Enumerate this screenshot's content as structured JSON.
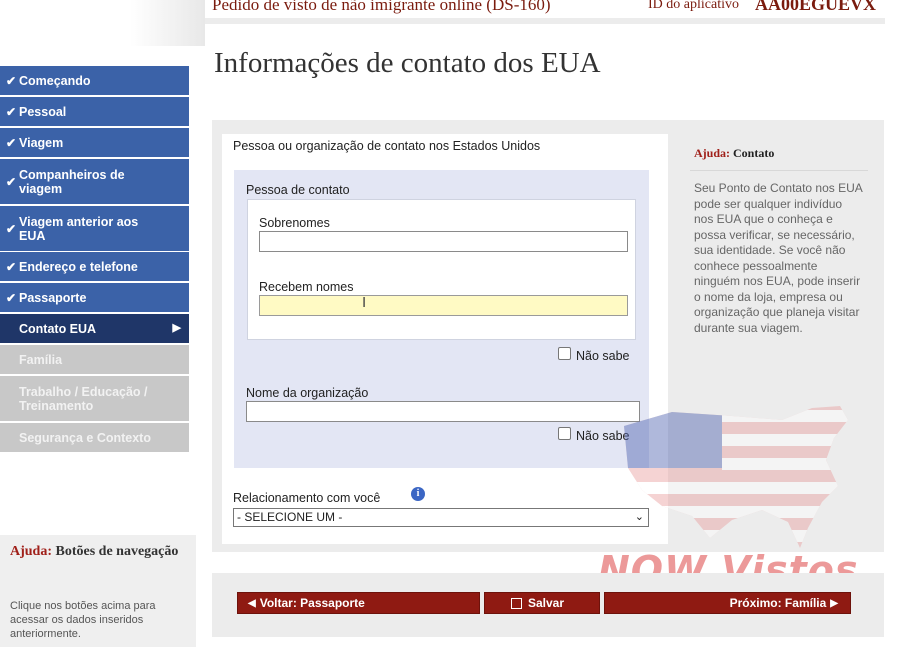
{
  "header": {
    "title": "Pedido de visto de não imigrante online (DS-160)",
    "app_id_label": "ID do aplicativo",
    "app_id_value": "AA00EGUEVX"
  },
  "sidebar": {
    "items": [
      {
        "label": "Começando",
        "state": "done"
      },
      {
        "label": "Pessoal",
        "state": "done"
      },
      {
        "label": "Viagem",
        "state": "done"
      },
      {
        "label": "Companheiros de viagem",
        "state": "done"
      },
      {
        "label": "Viagem anterior aos EUA",
        "state": "done"
      },
      {
        "label": "Endereço e telefone",
        "state": "done"
      },
      {
        "label": "Passaporte",
        "state": "done"
      },
      {
        "label": "Contato EUA",
        "state": "active"
      },
      {
        "label": "Família",
        "state": "disabled"
      },
      {
        "label": "Trabalho / Educação / Treinamento",
        "state": "disabled"
      },
      {
        "label": "Segurança e Contexto",
        "state": "disabled"
      }
    ],
    "help": {
      "title_prefix": "Ajuda:",
      "title_rest": "Botões de navegação",
      "text": "Clique nos botões acima para acessar os dados inseridos anteriormente."
    }
  },
  "page": {
    "title": "Informações de contato dos EUA"
  },
  "form": {
    "contact_question": "Pessoa ou organização de contato nos Estados Unidos",
    "contact_person_heading": "Pessoa de contato",
    "surnames_label": "Sobrenomes",
    "surnames_value": "",
    "given_names_label": "Recebem nomes",
    "given_names_value": "",
    "unknown_label": "Não sabe",
    "organization_label": "Nome da organização",
    "organization_value": "",
    "relationship_label": "Relacionamento com você",
    "relationship_selected": "- SELECIONE UM -"
  },
  "help_panel": {
    "title_prefix": "Ajuda:",
    "title_rest": "Contato",
    "text": "Seu Ponto de Contato nos EUA pode ser qualquer indivíduo nos EUA que o conheça e possa verificar, se necessário, sua identidade. Se você não conhece pessoalmente ninguém nos EUA, pode inserir o nome da loja, empresa ou organização que planeja visitar durante sua viagem."
  },
  "watermark": {
    "text": "NOW Vistos"
  },
  "bottom_nav": {
    "back_label": "Voltar: Passaporte",
    "save_label": "Salvar",
    "next_label": "Próximo: Família"
  },
  "colors": {
    "nav_done": "#3b62a8",
    "nav_active": "#1f3668",
    "nav_disabled": "#c8c8c8",
    "button": "#8f1a12",
    "brand_red": "#7a1b0e",
    "focus_field": "#fffac4"
  }
}
